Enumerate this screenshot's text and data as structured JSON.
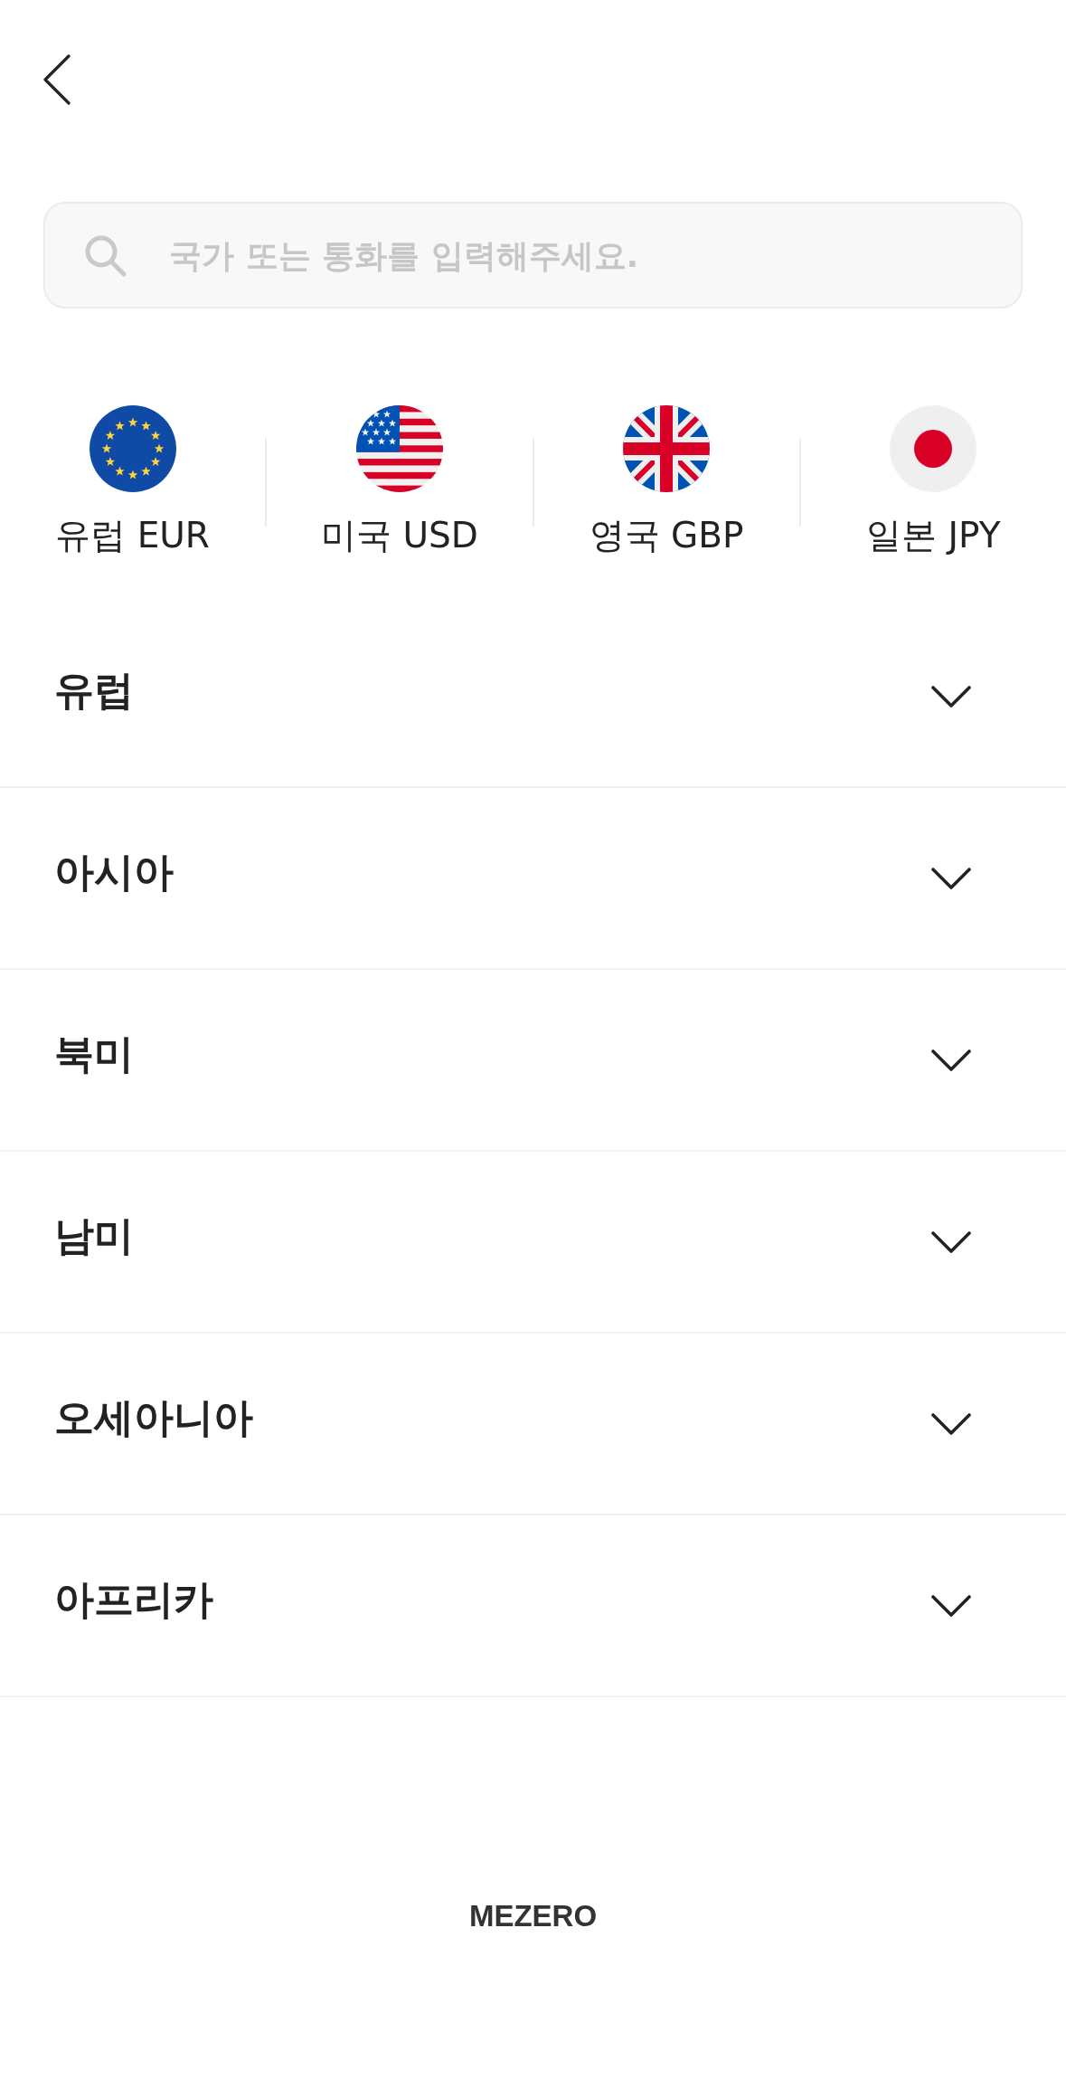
{
  "search": {
    "placeholder": "국가 또는 통화를 입력해주세요."
  },
  "quick_currencies": [
    {
      "kind": "eu",
      "label": "유럽 EUR"
    },
    {
      "kind": "us",
      "label": "미국 USD"
    },
    {
      "kind": "uk",
      "label": "영국 GBP"
    },
    {
      "kind": "jp",
      "label": "일본 JPY"
    }
  ],
  "regions": [
    {
      "name": "유럽",
      "expanded": false
    },
    {
      "name": "아시아",
      "expanded": false
    },
    {
      "name": "북미",
      "expanded": false
    },
    {
      "name": "남미",
      "expanded": false
    },
    {
      "name": "오세아니아",
      "expanded": false
    },
    {
      "name": "아프리카",
      "expanded": false
    }
  ],
  "footer": {
    "logo": "MEZERO"
  }
}
